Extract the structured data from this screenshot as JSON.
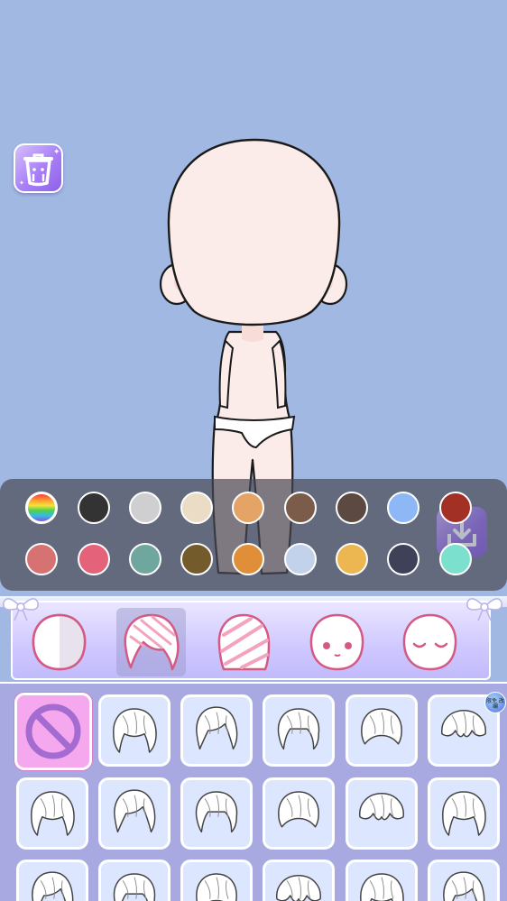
{
  "palette": {
    "colors": [
      "rainbow",
      "#333333",
      "#cfcfd1",
      "#ebdcc6",
      "#e3a465",
      "#7b5b4a",
      "#5c4a42",
      "#8db8f5",
      "#a33024",
      "#d77272",
      "#e4627a",
      "#6fa79e",
      "#735b2c",
      "#e08f38",
      "#c2d2ea",
      "#ecb750",
      "#3f4159",
      "#7be0cd"
    ]
  },
  "categories": [
    {
      "name": "skin"
    },
    {
      "name": "hair-front",
      "selected": true
    },
    {
      "name": "hair-back"
    },
    {
      "name": "face"
    },
    {
      "name": "eyes"
    }
  ],
  "badge": {
    "text": "限免 改编"
  }
}
